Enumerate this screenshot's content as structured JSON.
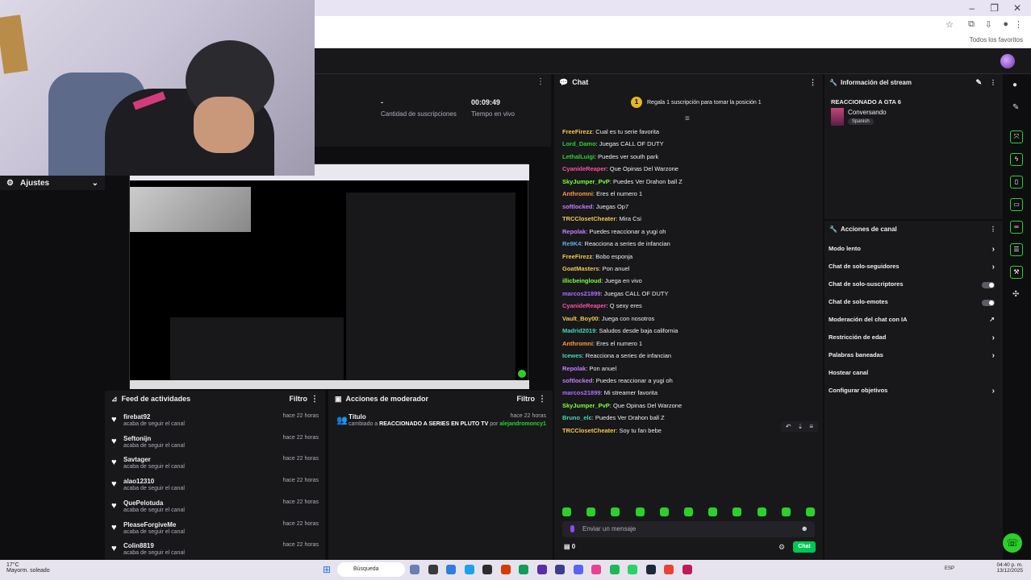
{
  "stats": {
    "viewers_value": "-",
    "subs_label": "Cantidad de suscripciones",
    "uptime_value": "00:09:49",
    "uptime_label": "Tiempo en vivo"
  },
  "sidebar": {
    "ajustes_label": "Ajustes"
  },
  "feed": {
    "title": "Feed de actividades",
    "filter_label": "Filtro",
    "items": [
      {
        "name": "firebat92",
        "sub": "acaba de seguir el canal",
        "time": "hace 22 horas"
      },
      {
        "name": "Seftonijn",
        "sub": "acaba de seguir el canal",
        "time": "hace 22 horas"
      },
      {
        "name": "Savtager",
        "sub": "acaba de seguir el canal",
        "time": "hace 22 horas"
      },
      {
        "name": "alao12310",
        "sub": "acaba de seguir el canal",
        "time": "hace 22 horas"
      },
      {
        "name": "QuePelotuda",
        "sub": "acaba de seguir el canal",
        "time": "hace 22 horas"
      },
      {
        "name": "PleaseForgiveMe",
        "sub": "acaba de seguir el canal",
        "time": "hace 22 horas"
      },
      {
        "name": "Colin8819",
        "sub": "acaba de seguir el canal",
        "time": "hace 22 horas"
      }
    ]
  },
  "moderator": {
    "title": "Acciones de moderador",
    "filter_label": "Filtro",
    "entry_title": "Título",
    "entry_time": "hace 22 horas",
    "entry_prefix": "cambiado a",
    "entry_value": "REACCIONADO A SERIES EN PLUTO TV",
    "entry_by": "por",
    "entry_user": "alejandromoncy1"
  },
  "chat": {
    "title": "Chat",
    "pinned": "Regala 1 suscripción para tomar la posición 1",
    "pinned_rank": "1",
    "messages": [
      {
        "user": "FreeFirezz",
        "color": "#f2c94c",
        "text": "Cual es tu serie favorita"
      },
      {
        "user": "Lord_Damo",
        "color": "#2bd12b",
        "text": "Juegas CALL OF DUTY"
      },
      {
        "user": "LethalLuigi",
        "color": "#2bd12b",
        "text": "Puedes ver south park"
      },
      {
        "user": "CyanideReaper",
        "color": "#ff4fa3",
        "text": "Que Opinas Del Warzone"
      },
      {
        "user": "SkyJumper_PvP",
        "color": "#7cff3a",
        "text": "Puedes Ver Drahon ball Z"
      },
      {
        "user": "Anthromni",
        "color": "#ff9a3c",
        "text": "Eres el numero 1"
      },
      {
        "user": "softlocked",
        "color": "#c77dff",
        "text": "Juegas Op7"
      },
      {
        "user": "TRCClosetCheater",
        "color": "#f2c94c",
        "text": "Mira Csi"
      },
      {
        "user": "Repolak",
        "color": "#c77dff",
        "text": "Puedes reaccionar a yugi oh"
      },
      {
        "user": "Re9K4",
        "color": "#5dade2",
        "text": "Reacciona a series de infancian"
      },
      {
        "user": "FreeFirezz",
        "color": "#f2c94c",
        "text": "Bobo esponja"
      },
      {
        "user": "GoatMasters",
        "color": "#f2c94c",
        "text": "Pon anuel"
      },
      {
        "user": "illicbeingloud",
        "color": "#7cff3a",
        "text": "Juega en vivo"
      },
      {
        "user": "marcos21899",
        "color": "#b06cff",
        "text": "Juegas CALL OF DUTY"
      },
      {
        "user": "CyanideReaper",
        "color": "#ff4fa3",
        "text": "Q sexy eres"
      },
      {
        "user": "Vault_Boy00",
        "color": "#f2c94c",
        "text": "Juega con nosotros"
      },
      {
        "user": "Madrid2019",
        "color": "#44d7b6",
        "text": "Saludos desde baja california"
      },
      {
        "user": "Anthromni",
        "color": "#ff9a3c",
        "text": "Eres el numero 1"
      },
      {
        "user": "Icewes",
        "color": "#44d7b6",
        "text": "Reacciona a series de infancian"
      },
      {
        "user": "Repolak",
        "color": "#c77dff",
        "text": "Pon anuel"
      },
      {
        "user": "softlocked",
        "color": "#c77dff",
        "text": "Puedes reaccionar a yugi oh"
      },
      {
        "user": "marcos21899",
        "color": "#b06cff",
        "text": "Mi streamer favorita"
      },
      {
        "user": "SkyJumper_PvP",
        "color": "#7cff3a",
        "text": "Que Opinas Del Warzone"
      },
      {
        "user": "Bruno_elc",
        "color": "#44d7b6",
        "text": "Puedes Ver Drahon ball Z"
      },
      {
        "user": "TRCClosetCheater",
        "color": "#f2c94c",
        "text": "Soy tu fan bebe"
      }
    ],
    "input_placeholder": "Enviar un mensaje",
    "points": "0",
    "send_label": "Chat"
  },
  "stream_info": {
    "title": "Información del stream",
    "stream_title": "REACCIONADO A GTA 6",
    "category": "Conversando",
    "tag": "Spanish"
  },
  "channel_actions": {
    "title": "Acciones de canal",
    "items": [
      {
        "label": "Modo lento",
        "control": "chevron"
      },
      {
        "label": "Chat de solo-seguidores",
        "control": "chevron"
      },
      {
        "label": "Chat de solo-suscriptores",
        "control": "toggle"
      },
      {
        "label": "Chat de solo-emotes",
        "control": "toggle"
      },
      {
        "label": "Moderación del chat con IA",
        "control": "external"
      },
      {
        "label": "Restricción de edad",
        "control": "chevron"
      },
      {
        "label": "Palabras baneadas",
        "control": "chevron"
      },
      {
        "label": "Hostear canal",
        "control": "none"
      },
      {
        "label": "Configurar objetivos",
        "control": "chevron"
      }
    ]
  },
  "browser": {
    "bookmarks_label": "Todos los favoritos"
  },
  "taskbar": {
    "temp": "17°C",
    "weather": "Mayorm. soleado",
    "search": "Búsqueda",
    "lang": "ESP",
    "time": "04:40 p. m.",
    "date": "13/12/2025"
  }
}
